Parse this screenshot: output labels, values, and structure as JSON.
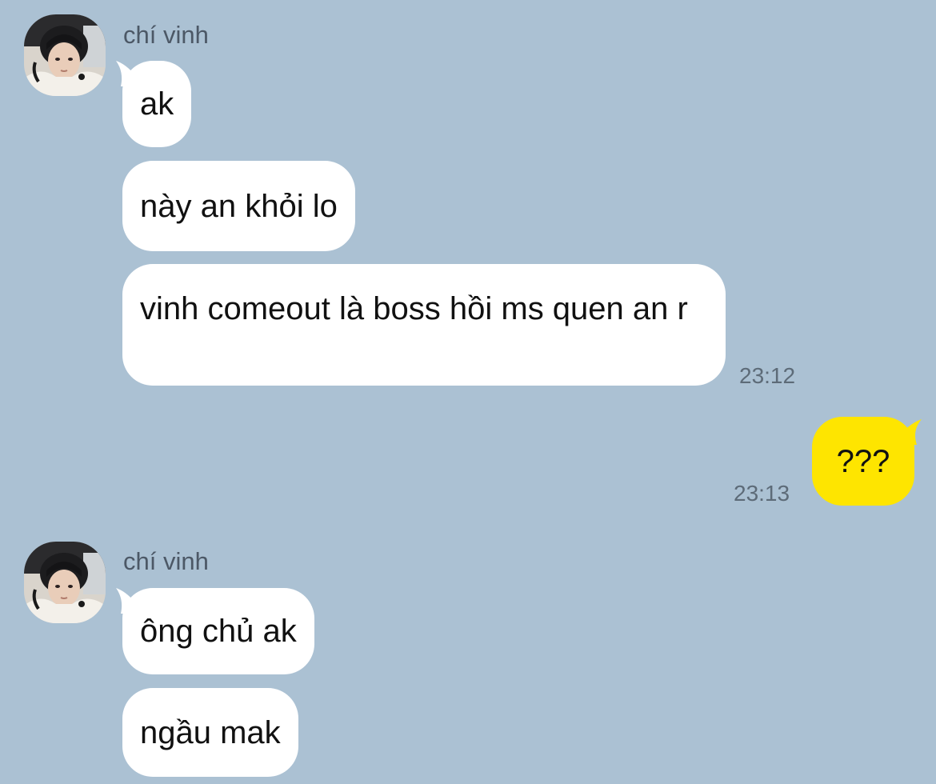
{
  "chat": {
    "groups": [
      {
        "sender": "chí vinh",
        "messages": [
          {
            "text": "ak"
          },
          {
            "text": "này an khỏi lo"
          },
          {
            "text": "vinh comeout là boss hồi ms quen an r"
          }
        ],
        "time": "23:12"
      },
      {
        "outgoing": true,
        "messages": [
          {
            "text": "???"
          }
        ],
        "time": "23:13"
      },
      {
        "sender": "chí vinh",
        "messages": [
          {
            "text": "ông chủ ak"
          },
          {
            "text": "ngầu mak"
          }
        ]
      }
    ]
  },
  "colors": {
    "background": "#abc1d3",
    "incoming_bubble": "#ffffff",
    "outgoing_bubble": "#fee500",
    "text": "#111111",
    "sender_name": "#4c5866",
    "timestamp": "#5d6b78"
  },
  "icons": {
    "avatar": "profile-photo-avatar"
  }
}
